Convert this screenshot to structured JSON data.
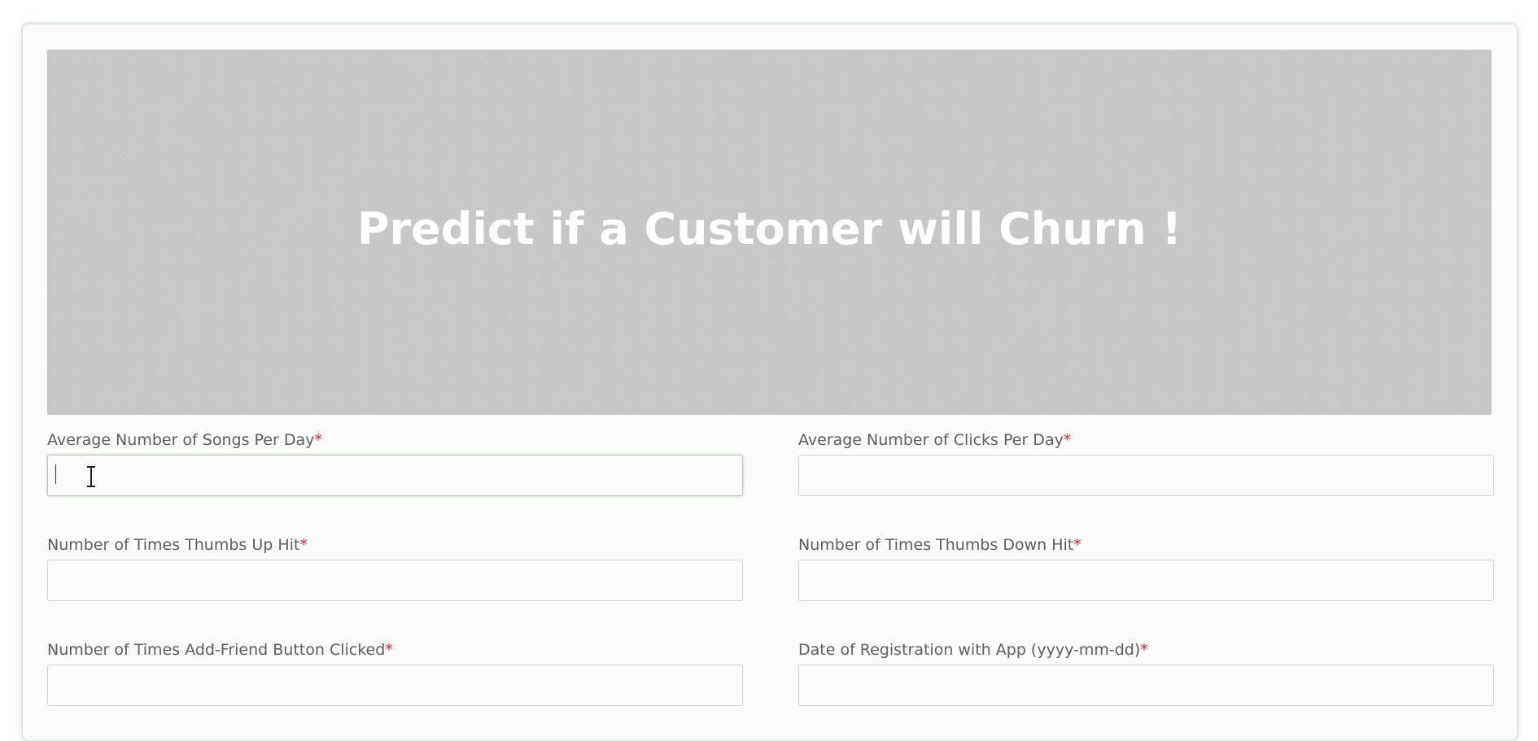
{
  "header": {
    "title": "Predict if a Customer will Churn !"
  },
  "form": {
    "required_marker": "*",
    "fields": [
      {
        "label": "Average Number of Songs Per Day",
        "value": "",
        "placeholder": ""
      },
      {
        "label": "Average Number of Clicks Per Day",
        "value": "",
        "placeholder": ""
      },
      {
        "label": "Number of Times Thumbs Up Hit",
        "value": "",
        "placeholder": ""
      },
      {
        "label": "Number of Times Thumbs Down Hit",
        "value": "",
        "placeholder": ""
      },
      {
        "label": "Number of Times Add-Friend Button Clicked",
        "value": "",
        "placeholder": ""
      },
      {
        "label": "Date of Registration with App (yyyy-mm-dd)",
        "value": "",
        "placeholder": ""
      }
    ]
  },
  "colors": {
    "banner_bg": "#c9c9c9",
    "required_marker": "#d8262c",
    "label_text": "#5e5e5e"
  },
  "icons": {
    "cursor": "text-cursor-icon"
  }
}
